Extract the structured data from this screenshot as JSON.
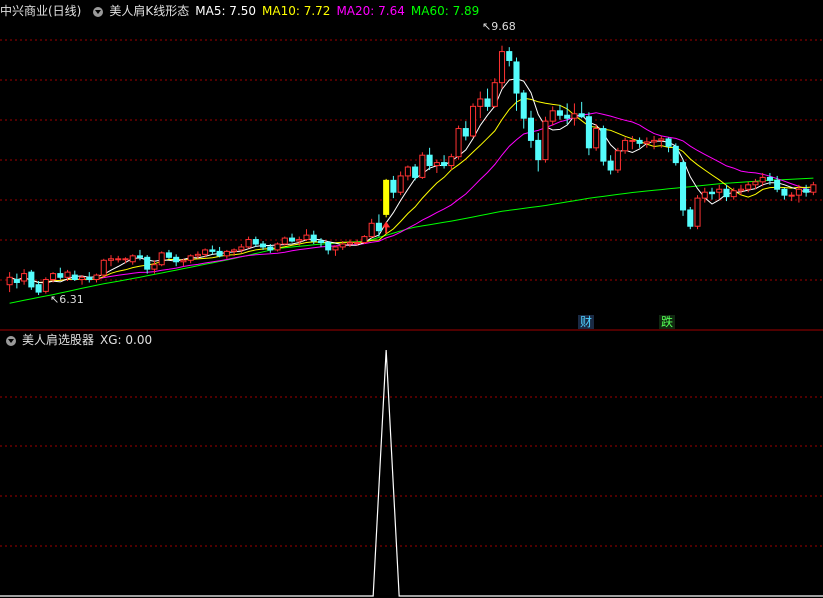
{
  "header": {
    "stock_name": "中兴商业(日线)",
    "indicator_name": "美人肩K线形态",
    "ma": [
      {
        "label": "MA5: 7.50",
        "color": "#ffffff"
      },
      {
        "label": "MA10: 7.72",
        "color": "#ffff00"
      },
      {
        "label": "MA20: 7.64",
        "color": "#ff00ff"
      },
      {
        "label": "MA60: 7.89",
        "color": "#00ff00"
      }
    ]
  },
  "sub_header": {
    "indicator_name": "美人肩选股器",
    "xg_label": "XG: 0.00"
  },
  "markers": {
    "high_label": "9.68",
    "low_label": "6.31",
    "cai_label": "财",
    "die_label": "跌"
  },
  "colors": {
    "background": "#000000",
    "up": "#ff3232",
    "down": "#54fcfc",
    "signal": "#ffff00",
    "grid": "#a00000",
    "ma5": "#ffffff",
    "ma10": "#ffff00",
    "ma20": "#ff00ff",
    "ma60": "#00ff00"
  },
  "chart_data": [
    {
      "type": "candlestick",
      "title": "中兴商业(日线)",
      "ylim": [
        6.0,
        10.0
      ],
      "note_values": "each candle: [open, high, low, close]",
      "candles": [
        [
          6.45,
          6.62,
          6.35,
          6.55
        ],
        [
          6.52,
          6.6,
          6.4,
          6.48
        ],
        [
          6.5,
          6.66,
          6.45,
          6.6
        ],
        [
          6.62,
          6.65,
          6.38,
          6.42
        ],
        [
          6.45,
          6.5,
          6.31,
          6.35
        ],
        [
          6.36,
          6.55,
          6.33,
          6.52
        ],
        [
          6.52,
          6.62,
          6.48,
          6.6
        ],
        [
          6.6,
          6.68,
          6.52,
          6.55
        ],
        [
          6.55,
          6.65,
          6.5,
          6.62
        ],
        [
          6.58,
          6.64,
          6.5,
          6.52
        ],
        [
          6.52,
          6.58,
          6.45,
          6.55
        ],
        [
          6.55,
          6.62,
          6.48,
          6.52
        ],
        [
          6.52,
          6.6,
          6.48,
          6.58
        ],
        [
          6.58,
          6.8,
          6.55,
          6.78
        ],
        [
          6.78,
          6.85,
          6.7,
          6.8
        ],
        [
          6.8,
          6.84,
          6.75,
          6.8
        ],
        [
          6.8,
          6.82,
          6.74,
          6.8
        ],
        [
          6.76,
          6.86,
          6.72,
          6.84
        ],
        [
          6.84,
          6.92,
          6.78,
          6.82
        ],
        [
          6.82,
          6.85,
          6.6,
          6.66
        ],
        [
          6.66,
          6.78,
          6.6,
          6.72
        ],
        [
          6.72,
          6.9,
          6.7,
          6.88
        ],
        [
          6.88,
          6.92,
          6.8,
          6.82
        ],
        [
          6.82,
          6.86,
          6.7,
          6.76
        ],
        [
          6.76,
          6.8,
          6.7,
          6.78
        ],
        [
          6.78,
          6.86,
          6.74,
          6.84
        ],
        [
          6.84,
          6.9,
          6.8,
          6.86
        ],
        [
          6.86,
          6.94,
          6.82,
          6.92
        ],
        [
          6.92,
          6.98,
          6.86,
          6.9
        ],
        [
          6.9,
          6.96,
          6.82,
          6.84
        ],
        [
          6.84,
          6.92,
          6.8,
          6.9
        ],
        [
          6.9,
          6.94,
          6.84,
          6.92
        ],
        [
          6.92,
          7.0,
          6.88,
          6.96
        ],
        [
          6.96,
          7.1,
          6.94,
          7.06
        ],
        [
          7.06,
          7.1,
          6.96,
          7.0
        ],
        [
          7.0,
          7.04,
          6.92,
          6.96
        ],
        [
          6.96,
          7.0,
          6.88,
          6.92
        ],
        [
          6.92,
          7.02,
          6.9,
          7.0
        ],
        [
          7.0,
          7.1,
          6.98,
          7.08
        ],
        [
          7.08,
          7.14,
          7.02,
          7.04
        ],
        [
          7.04,
          7.1,
          6.98,
          7.06
        ],
        [
          7.06,
          7.2,
          7.04,
          7.12
        ],
        [
          7.12,
          7.18,
          7.0,
          7.04
        ],
        [
          7.04,
          7.08,
          6.96,
          7.02
        ],
        [
          7.02,
          7.04,
          6.86,
          6.92
        ],
        [
          6.92,
          6.98,
          6.84,
          6.96
        ],
        [
          6.96,
          7.04,
          6.92,
          7.0
        ],
        [
          7.0,
          7.06,
          6.96,
          7.02
        ],
        [
          7.02,
          7.06,
          6.98,
          7.02
        ],
        [
          7.02,
          7.12,
          7.0,
          7.1
        ],
        [
          7.1,
          7.34,
          7.08,
          7.28
        ],
        [
          7.28,
          7.4,
          7.1,
          7.18
        ],
        [
          7.4,
          7.88,
          7.36,
          7.86
        ],
        [
          7.86,
          7.92,
          7.62,
          7.7
        ],
        [
          7.7,
          7.98,
          7.66,
          7.92
        ],
        [
          7.92,
          8.06,
          7.86,
          8.04
        ],
        [
          8.04,
          8.08,
          7.86,
          7.9
        ],
        [
          7.9,
          8.24,
          7.88,
          8.2
        ],
        [
          8.2,
          8.3,
          8.0,
          8.06
        ],
        [
          8.06,
          8.14,
          7.96,
          8.1
        ],
        [
          8.1,
          8.2,
          8.02,
          8.06
        ],
        [
          8.06,
          8.22,
          8.0,
          8.18
        ],
        [
          8.18,
          8.6,
          8.14,
          8.56
        ],
        [
          8.56,
          8.66,
          8.4,
          8.46
        ],
        [
          8.46,
          8.9,
          8.44,
          8.86
        ],
        [
          8.86,
          9.06,
          8.7,
          8.96
        ],
        [
          8.96,
          9.1,
          8.8,
          8.86
        ],
        [
          8.86,
          9.24,
          8.84,
          9.18
        ],
        [
          9.18,
          9.68,
          9.1,
          9.6
        ],
        [
          9.6,
          9.66,
          9.4,
          9.48
        ],
        [
          9.46,
          9.52,
          8.8,
          9.04
        ],
        [
          9.04,
          9.08,
          8.56,
          8.7
        ],
        [
          8.7,
          8.8,
          8.3,
          8.4
        ],
        [
          8.4,
          8.5,
          7.98,
          8.14
        ],
        [
          8.14,
          8.72,
          8.1,
          8.66
        ],
        [
          8.66,
          8.86,
          8.6,
          8.8
        ],
        [
          8.8,
          8.88,
          8.68,
          8.74
        ],
        [
          8.74,
          8.9,
          8.62,
          8.7
        ],
        [
          8.7,
          8.9,
          8.6,
          8.76
        ],
        [
          8.76,
          8.92,
          8.7,
          8.72
        ],
        [
          8.72,
          8.78,
          8.2,
          8.3
        ],
        [
          8.3,
          8.62,
          8.26,
          8.56
        ],
        [
          8.56,
          8.6,
          8.06,
          8.12
        ],
        [
          8.12,
          8.2,
          7.94,
          8.0
        ],
        [
          8.0,
          8.3,
          7.96,
          8.26
        ],
        [
          8.26,
          8.44,
          8.22,
          8.4
        ],
        [
          8.4,
          8.46,
          8.28,
          8.4
        ],
        [
          8.4,
          8.44,
          8.3,
          8.36
        ],
        [
          8.36,
          8.44,
          8.3,
          8.38
        ],
        [
          8.38,
          8.46,
          8.28,
          8.4
        ],
        [
          8.4,
          8.46,
          8.3,
          8.42
        ],
        [
          8.42,
          8.44,
          8.24,
          8.32
        ],
        [
          8.32,
          8.36,
          8.06,
          8.1
        ],
        [
          8.1,
          8.14,
          7.38,
          7.46
        ],
        [
          7.46,
          7.5,
          7.2,
          7.24
        ],
        [
          7.24,
          7.66,
          7.2,
          7.62
        ],
        [
          7.62,
          7.76,
          7.56,
          7.7
        ],
        [
          7.7,
          7.76,
          7.6,
          7.68
        ],
        [
          7.7,
          7.8,
          7.6,
          7.74
        ],
        [
          7.74,
          7.8,
          7.58,
          7.64
        ],
        [
          7.64,
          7.76,
          7.6,
          7.72
        ],
        [
          7.72,
          7.8,
          7.66,
          7.74
        ],
        [
          7.74,
          7.84,
          7.7,
          7.8
        ],
        [
          7.8,
          7.88,
          7.74,
          7.84
        ],
        [
          7.84,
          7.96,
          7.78,
          7.9
        ],
        [
          7.9,
          7.96,
          7.8,
          7.86
        ],
        [
          7.86,
          7.92,
          7.7,
          7.74
        ],
        [
          7.74,
          7.76,
          7.6,
          7.66
        ],
        [
          7.66,
          7.7,
          7.58,
          7.66
        ],
        [
          7.66,
          7.8,
          7.56,
          7.74
        ],
        [
          7.74,
          7.8,
          7.64,
          7.7
        ],
        [
          7.7,
          7.84,
          7.66,
          7.8
        ]
      ],
      "ma60": [
        6.2,
        6.32,
        6.45,
        6.56,
        6.68,
        6.8,
        6.94,
        7.0,
        7.04,
        7.22,
        7.32,
        7.44,
        7.52,
        7.62,
        7.7,
        7.76,
        7.82,
        7.86,
        7.89
      ],
      "signal_index": 52
    },
    {
      "type": "line",
      "title": "美人肩选股器",
      "ylim": [
        0,
        1
      ],
      "spike_index": 52,
      "value_now": 0.0
    }
  ]
}
